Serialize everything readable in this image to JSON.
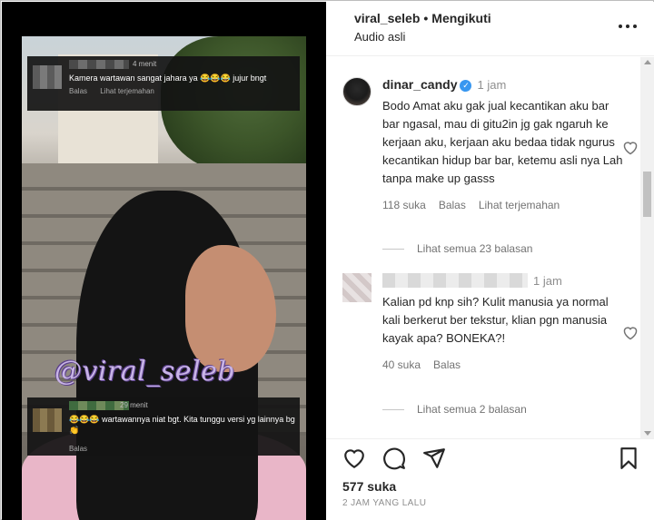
{
  "video": {
    "watermark": "@viral_seleb",
    "overlay_top": {
      "time": "4 menit",
      "text": "Kamera wartawan sangat jahara ya 😂😂😂 jujur bngt",
      "reply": "Balas",
      "translate": "Lihat terjemahan"
    },
    "overlay_bottom": {
      "time": "29 menit",
      "text": "😂😂😂 wartawannya niat bgt. Kita tunggu versi yg lainnya bg👏",
      "reply": "Balas"
    }
  },
  "header": {
    "account": "viral_seleb",
    "separator": "•",
    "follow_status": "Mengikuti",
    "audio": "Audio asli"
  },
  "comments": [
    {
      "user": "dinar_candy",
      "time": "1 jam",
      "text": "Bodo Amat aku gak jual kecantikan aku bar bar ngasal, mau di gitu2in jg gak ngaruh ke kerjaan aku, kerjaan aku bedaa tidak ngurus kecantikan hidup bar bar, ketemu asli nya Lah tanpa make up gasss",
      "likes": "118 suka",
      "reply": "Balas",
      "translate": "Lihat terjemahan",
      "view_replies": "Lihat semua 23 balasan"
    },
    {
      "time": "1 jam",
      "text": "Kalian pd knp sih? Kulit manusia ya normal kali berkerut ber tekstur, klian pgn manusia kayak apa? BONEKA?!",
      "likes": "40 suka",
      "reply": "Balas",
      "view_replies": "Lihat semua 2 balasan"
    }
  ],
  "post": {
    "likes": "577 suka",
    "date": "2 JAM YANG LALU"
  },
  "icons": {
    "verified": "verified-badge-icon",
    "heart": "heart-icon",
    "comment": "comment-icon",
    "share": "share-icon",
    "save": "bookmark-icon",
    "more": "more-options-icon"
  },
  "colors": {
    "verified": "#3897f0",
    "text": "#262626",
    "muted": "#8e8e8e"
  }
}
